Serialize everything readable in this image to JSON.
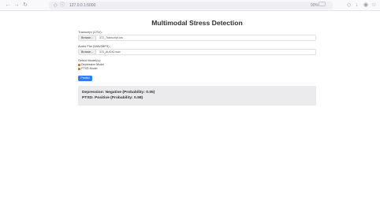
{
  "browser": {
    "url": "127.0.0.1:5000",
    "url_right": "90%"
  },
  "page": {
    "title": "Multimodal Stress Detection"
  },
  "transcript": {
    "label": "Transcript (CSV):",
    "browse_label": "Browse...",
    "filename": "372_Transcript.csv"
  },
  "audio": {
    "label": "Audio File (WAV/MP3):",
    "browse_label": "Browse...",
    "filename": "372_AUDIO.wav"
  },
  "models": {
    "label": "Select Model(s):",
    "options": [
      {
        "label": "Depression Model",
        "checked": true
      },
      {
        "label": "PTSD Model",
        "checked": true
      }
    ],
    "checkbox_color": "#e07b39"
  },
  "predict_label": "Predict",
  "accent_color": "#2f7df6",
  "results": [
    "Depression: Negative (Probability: 0.05)",
    "PTSD: Positive (Probability: 0.98)"
  ]
}
